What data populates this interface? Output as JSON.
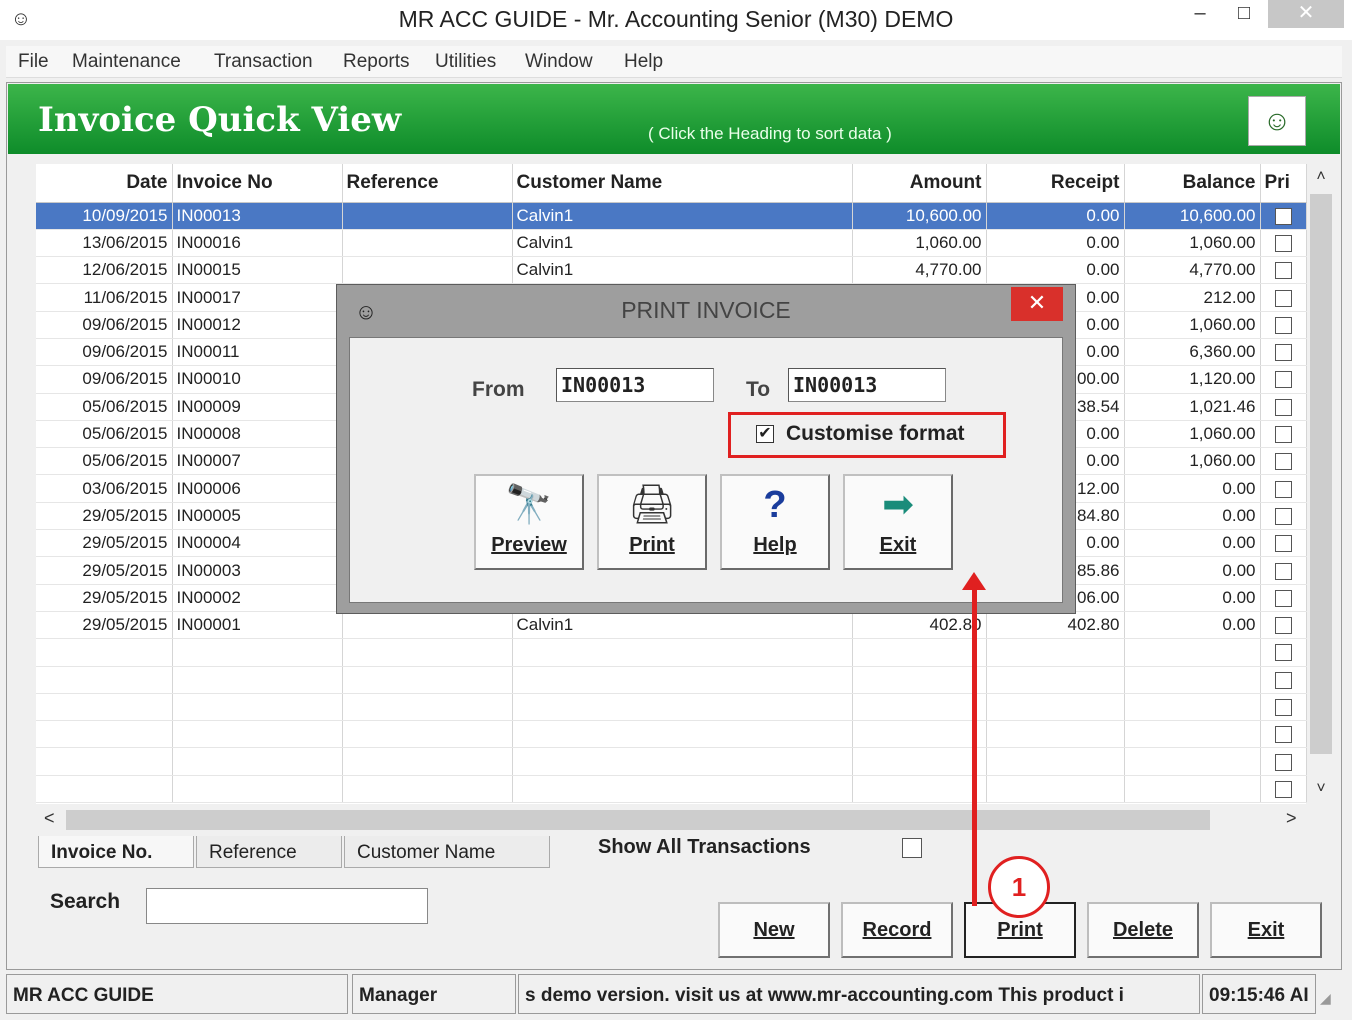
{
  "window": {
    "title": "MR ACC GUIDE - Mr. Accounting Senior (M30) DEMO",
    "min": "–",
    "max": "□",
    "close": "✕"
  },
  "menu": [
    "File",
    "Maintenance",
    "Transaction",
    "Reports",
    "Utilities",
    "Window",
    "Help"
  ],
  "banner": {
    "heading": "Invoice Quick View",
    "hint": "( Click the Heading to sort data )"
  },
  "columns": [
    "Date",
    "Invoice No",
    "Reference",
    "Customer Name",
    "Amount",
    "Receipt",
    "Balance",
    "Pri"
  ],
  "rows": [
    {
      "date": "10/09/2015",
      "invoice": "IN00013",
      "reference": "",
      "customer": "Calvin1",
      "amount": "10,600.00",
      "receipt": "0.00",
      "balance": "10,600.00"
    },
    {
      "date": "13/06/2015",
      "invoice": "IN00016",
      "reference": "",
      "customer": "Calvin1",
      "amount": "1,060.00",
      "receipt": "0.00",
      "balance": "1,060.00"
    },
    {
      "date": "12/06/2015",
      "invoice": "IN00015",
      "reference": "",
      "customer": "Calvin1",
      "amount": "4,770.00",
      "receipt": "0.00",
      "balance": "4,770.00"
    },
    {
      "date": "11/06/2015",
      "invoice": "IN00017",
      "reference": "",
      "customer": "",
      "amount": "",
      "receipt": "0.00",
      "balance": "212.00"
    },
    {
      "date": "09/06/2015",
      "invoice": "IN00012",
      "reference": "",
      "customer": "",
      "amount": "",
      "receipt": "0.00",
      "balance": "1,060.00"
    },
    {
      "date": "09/06/2015",
      "invoice": "IN00011",
      "reference": "",
      "customer": "",
      "amount": "",
      "receipt": "0.00",
      "balance": "6,360.00"
    },
    {
      "date": "09/06/2015",
      "invoice": "IN00010",
      "reference": "",
      "customer": "",
      "amount": "",
      "receipt": "00.00",
      "balance": "1,120.00"
    },
    {
      "date": "05/06/2015",
      "invoice": "IN00009",
      "reference": "",
      "customer": "",
      "amount": "",
      "receipt": "38.54",
      "balance": "1,021.46"
    },
    {
      "date": "05/06/2015",
      "invoice": "IN00008",
      "reference": "",
      "customer": "",
      "amount": "",
      "receipt": "0.00",
      "balance": "1,060.00"
    },
    {
      "date": "05/06/2015",
      "invoice": "IN00007",
      "reference": "",
      "customer": "",
      "amount": "",
      "receipt": "0.00",
      "balance": "1,060.00"
    },
    {
      "date": "03/06/2015",
      "invoice": "IN00006",
      "reference": "",
      "customer": "",
      "amount": "",
      "receipt": "12.00",
      "balance": "0.00"
    },
    {
      "date": "29/05/2015",
      "invoice": "IN00005",
      "reference": "",
      "customer": "",
      "amount": "",
      "receipt": "84.80",
      "balance": "0.00"
    },
    {
      "date": "29/05/2015",
      "invoice": "IN00004",
      "reference": "",
      "customer": "",
      "amount": "",
      "receipt": "0.00",
      "balance": "0.00"
    },
    {
      "date": "29/05/2015",
      "invoice": "IN00003",
      "reference": "",
      "customer": "",
      "amount": "",
      "receipt": "85.86",
      "balance": "0.00"
    },
    {
      "date": "29/05/2015",
      "invoice": "IN00002",
      "reference": "",
      "customer": "",
      "amount": "",
      "receipt": "06.00",
      "balance": "0.00"
    },
    {
      "date": "29/05/2015",
      "invoice": "IN00001",
      "reference": "",
      "customer": "Calvin1",
      "amount": "402.80",
      "receipt": "402.80",
      "balance": "0.00"
    },
    {
      "date": "",
      "invoice": "",
      "reference": "",
      "customer": "",
      "amount": "",
      "receipt": "",
      "balance": ""
    },
    {
      "date": "",
      "invoice": "",
      "reference": "",
      "customer": "",
      "amount": "",
      "receipt": "",
      "balance": ""
    },
    {
      "date": "",
      "invoice": "",
      "reference": "",
      "customer": "",
      "amount": "",
      "receipt": "",
      "balance": ""
    },
    {
      "date": "",
      "invoice": "",
      "reference": "",
      "customer": "",
      "amount": "",
      "receipt": "",
      "balance": ""
    },
    {
      "date": "",
      "invoice": "",
      "reference": "",
      "customer": "",
      "amount": "",
      "receipt": "",
      "balance": ""
    },
    {
      "date": "",
      "invoice": "",
      "reference": "",
      "customer": "",
      "amount": "",
      "receipt": "",
      "balance": ""
    }
  ],
  "scroll": {
    "up": "˄",
    "down": "˅",
    "left": "<",
    "right": ">"
  },
  "tabs": [
    "Invoice No.",
    "Reference",
    "Customer Name"
  ],
  "show_all_label": "Show All Transactions",
  "search_label": "Search",
  "search_value": "",
  "buttons": [
    "New",
    "Record",
    "Print",
    "Delete",
    "Exit"
  ],
  "status": {
    "company": "MR ACC GUIDE",
    "user": "Manager",
    "message": "s demo version.  visit us at www.mr-accounting.com This product i",
    "time": "09:15:46 AI"
  },
  "dialog": {
    "title": "PRINT INVOICE",
    "close": "✕",
    "from_label": "From",
    "from_value": "IN00013",
    "to_label": "To",
    "to_value": "IN00013",
    "customise_label": "Customise format",
    "customise_checked": "✔",
    "buttons": [
      {
        "label": "Preview",
        "icon": "binoculars-icon",
        "glyph": "🔭"
      },
      {
        "label": "Print",
        "icon": "printer-icon",
        "glyph": "🖨"
      },
      {
        "label": "Help",
        "icon": "help-icon",
        "glyph": "?"
      },
      {
        "label": "Exit",
        "icon": "exit-door-icon",
        "glyph": "➡"
      }
    ]
  },
  "annotation": {
    "step": "1",
    "color": "#e02020"
  },
  "colors": {
    "banner": "#0e8c2a",
    "selection": "#4a78c4",
    "highlight": "#e02020"
  }
}
